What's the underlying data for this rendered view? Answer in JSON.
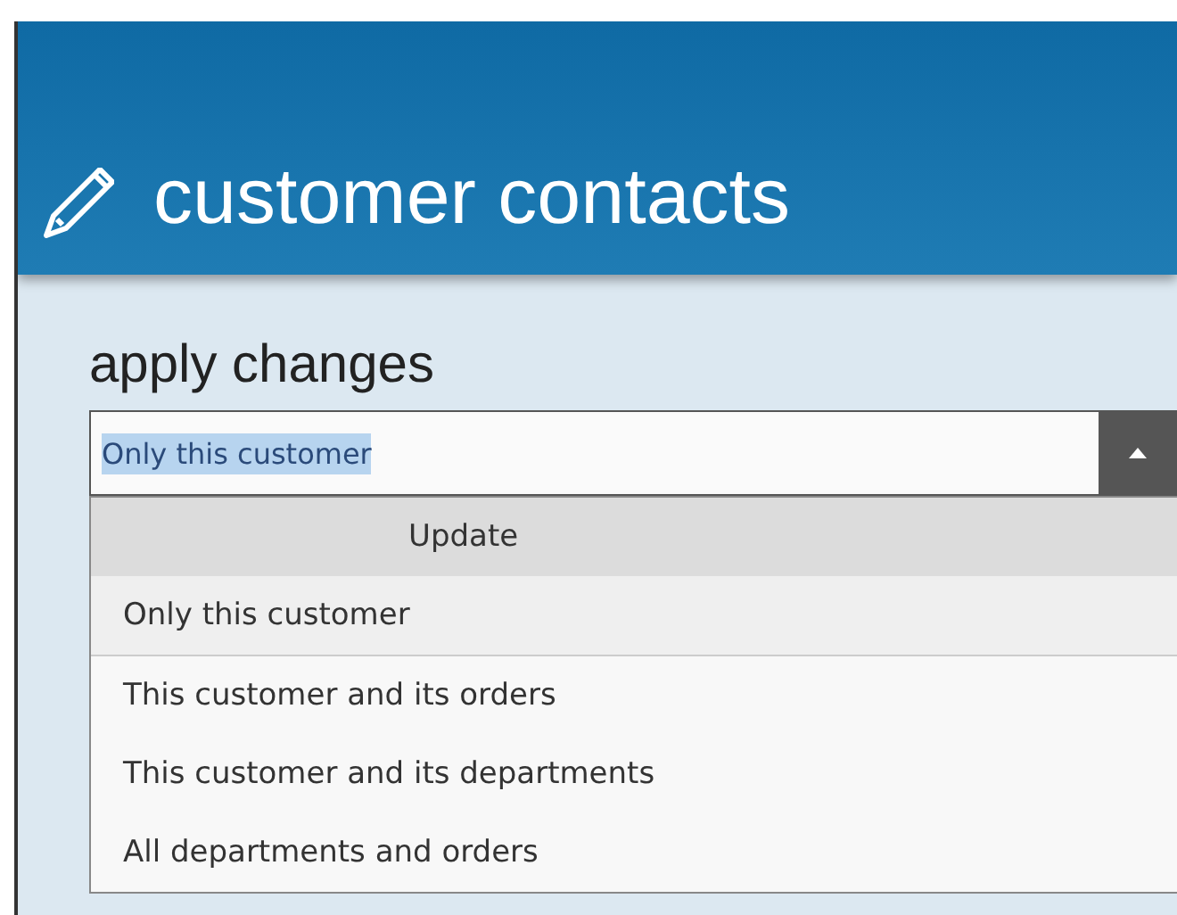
{
  "header": {
    "title": "customer contacts"
  },
  "form": {
    "label": "apply changes",
    "combo": {
      "value": "Only this customer",
      "expanded": true
    }
  },
  "dropdown": {
    "column": "Update",
    "options": [
      {
        "label": "Only this customer",
        "selected": true
      },
      {
        "label": "This customer and its orders",
        "selected": false
      },
      {
        "label": "This customer and its departments",
        "selected": false
      },
      {
        "label": "All departments and orders",
        "selected": false
      }
    ]
  }
}
